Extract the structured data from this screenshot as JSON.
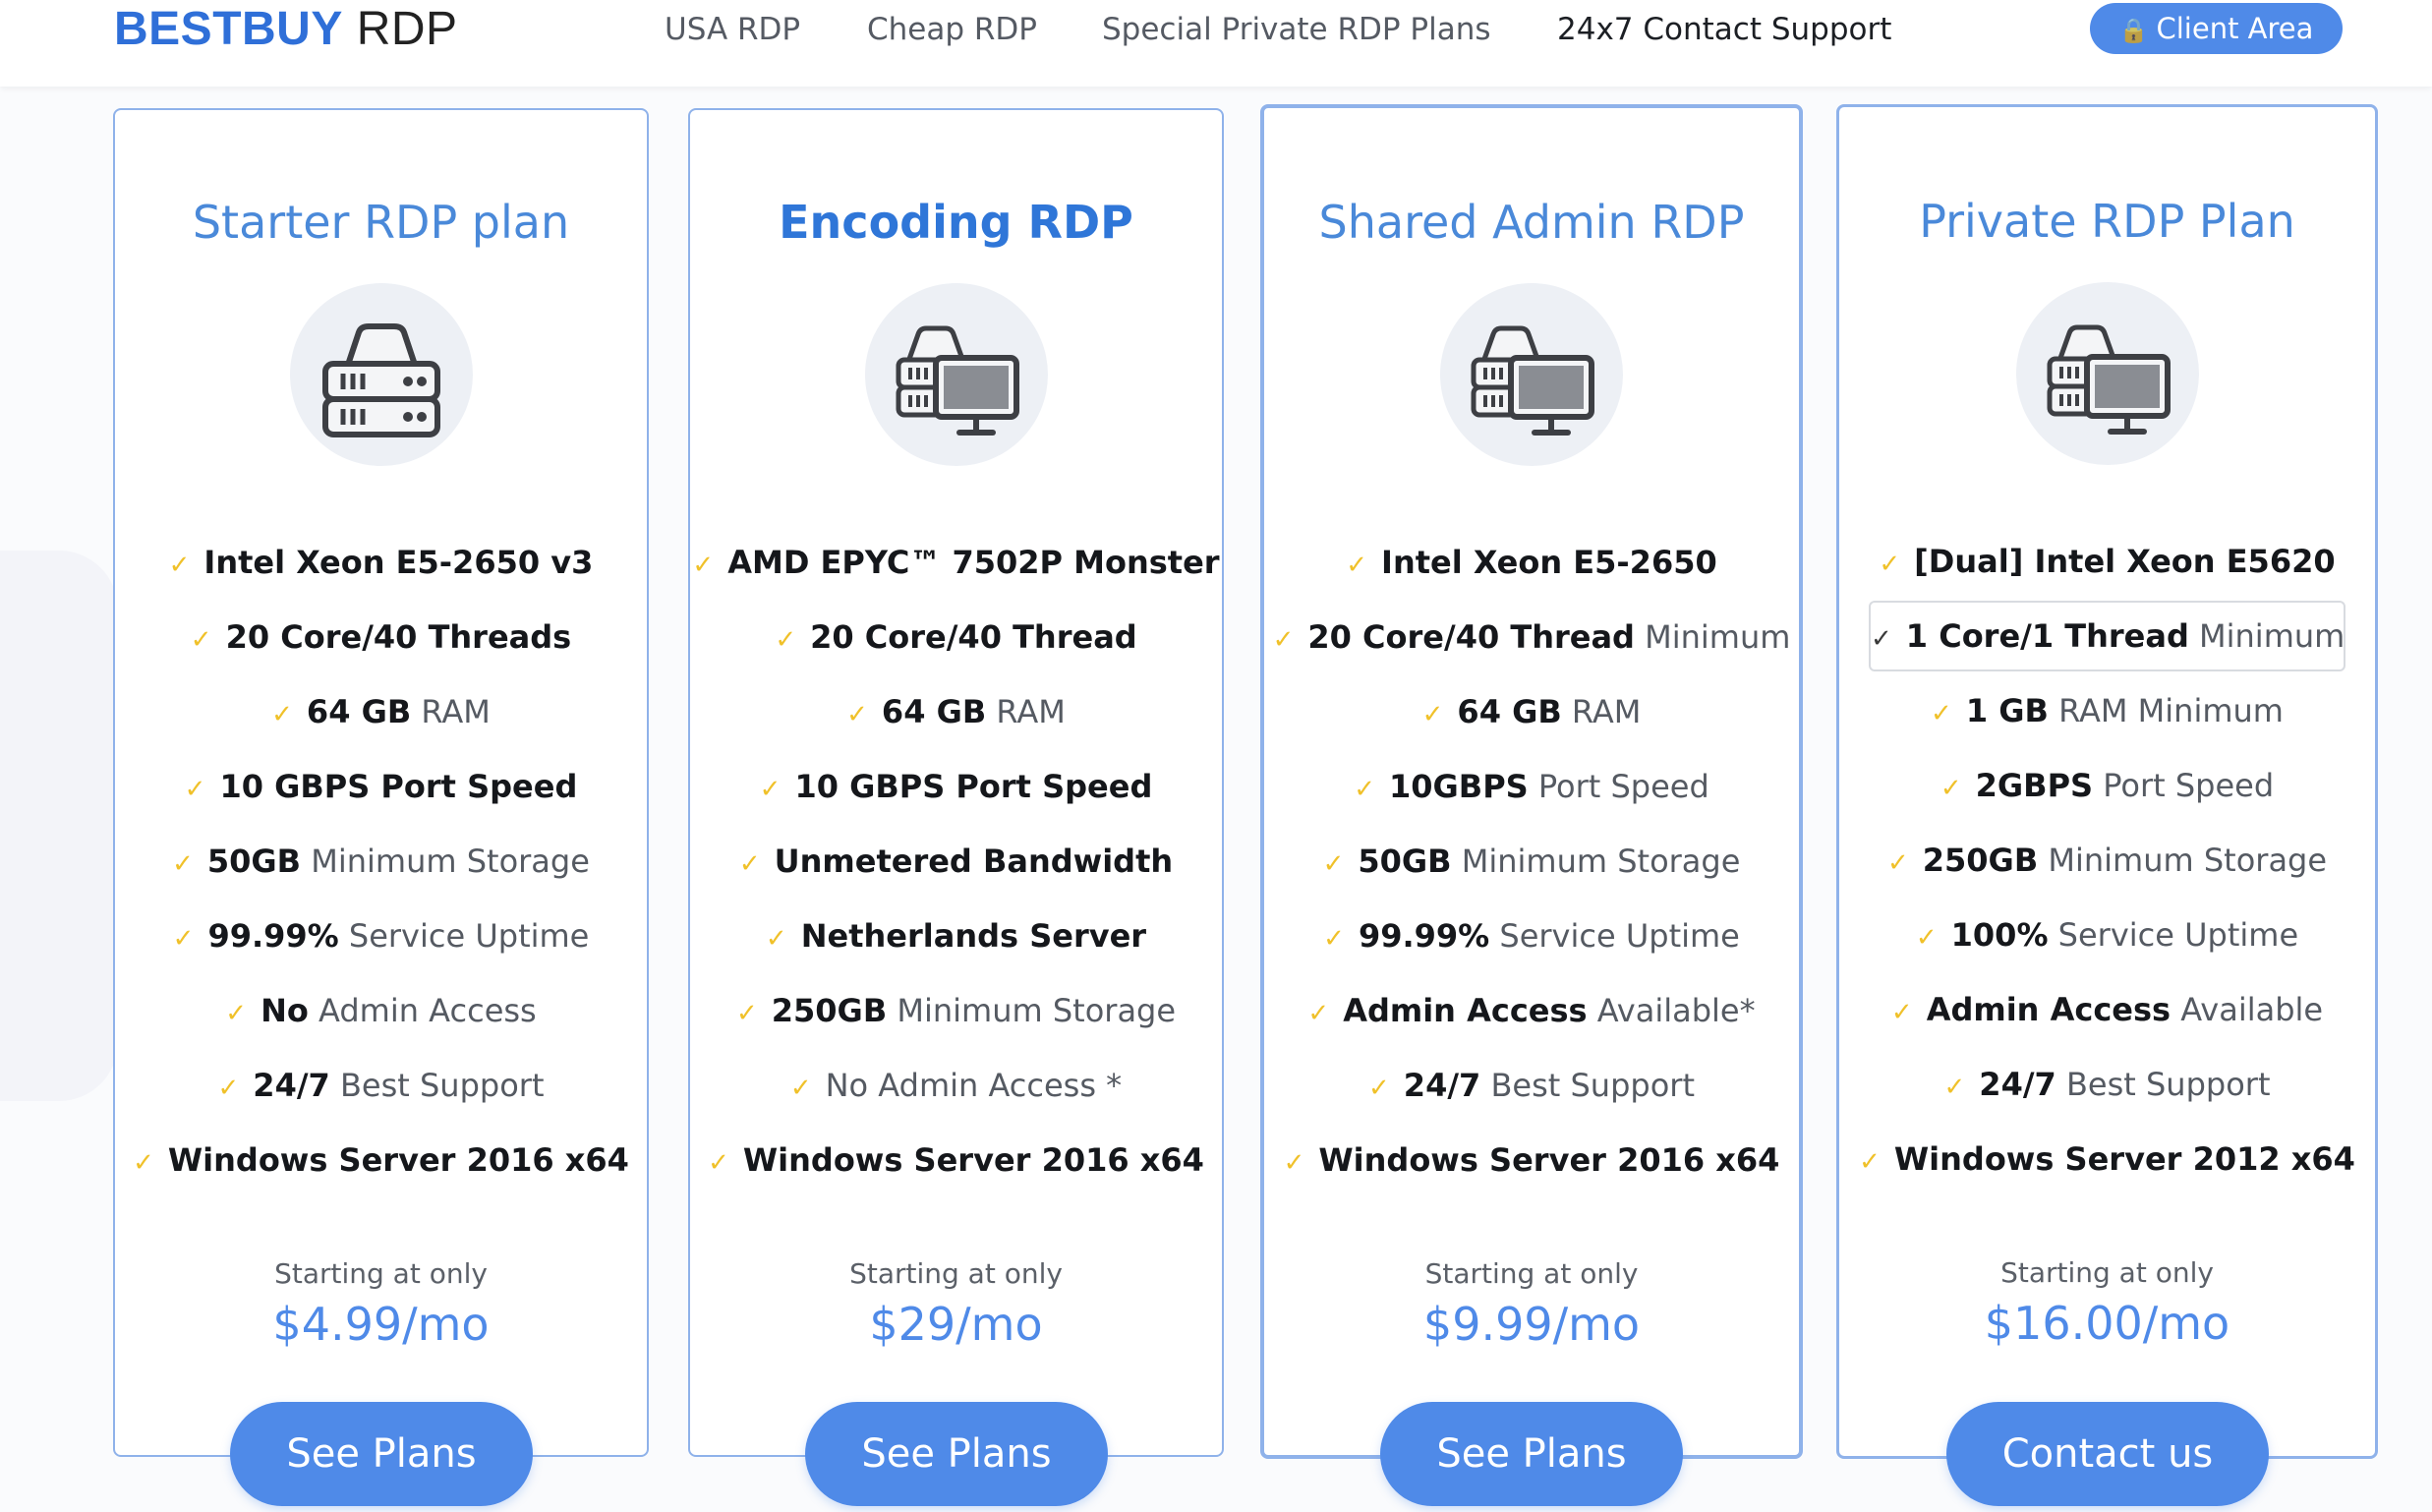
{
  "header": {
    "logo_brand": "BESTBUY",
    "logo_suffix": "RDP",
    "nav": [
      "USA RDP",
      "Cheap RDP",
      "Special Private RDP Plans",
      "24x7 Contact Support"
    ],
    "client_area": "Client Area"
  },
  "icons": {
    "server": "server-icon",
    "server_monitor": "server-monitor-icon",
    "check": "check-icon",
    "lock": "lock-icon"
  },
  "colors": {
    "accent": "#4f8ae8",
    "brand": "#2f6fd8",
    "check": "#f0c12a",
    "border": "#8fb2ea"
  },
  "plans": [
    {
      "title": "Starter RDP plan",
      "features": [
        {
          "bold": "Intel Xeon E5-2650 v3",
          "light": ""
        },
        {
          "bold": "20 Core/40 Threads",
          "light": ""
        },
        {
          "bold": "64 GB",
          "light": " RAM"
        },
        {
          "bold": "10 GBPS Port Speed",
          "light": ""
        },
        {
          "bold": "50GB",
          "light": " Minimum Storage"
        },
        {
          "bold": "99.99%",
          "light": " Service Uptime"
        },
        {
          "bold": "No",
          "light": " Admin Access"
        },
        {
          "bold": "24/7",
          "light": " Best Support"
        },
        {
          "bold": "Windows Server 2016 x64",
          "light": ""
        }
      ],
      "starting": "Starting at only",
      "price": "$4.99/mo",
      "button": "See Plans"
    },
    {
      "title": "Encoding RDP",
      "features": [
        {
          "bold": "AMD EPYC™ 7502P Monster",
          "light": ""
        },
        {
          "bold": "20 Core/40 Thread",
          "light": ""
        },
        {
          "bold": "64 GB",
          "light": " RAM"
        },
        {
          "bold": "10 GBPS Port Speed",
          "light": ""
        },
        {
          "bold": "Unmetered Bandwidth",
          "light": ""
        },
        {
          "bold": "Netherlands Server",
          "light": ""
        },
        {
          "bold": "250GB",
          "light": " Minimum Storage"
        },
        {
          "bold": "",
          "light": "No Admin Access *"
        },
        {
          "bold": "Windows Server 2016 x64",
          "light": ""
        }
      ],
      "starting": "Starting at only",
      "price": "$29/mo",
      "button": "See Plans"
    },
    {
      "title": "Shared Admin RDP",
      "features": [
        {
          "bold": "Intel Xeon E5-2650",
          "light": ""
        },
        {
          "bold": "20 Core/40 Thread",
          "light": " Minimum"
        },
        {
          "bold": "64 GB",
          "light": " RAM"
        },
        {
          "bold": "10GBPS",
          "light": " Port Speed"
        },
        {
          "bold": "50GB",
          "light": " Minimum Storage"
        },
        {
          "bold": "99.99%",
          "light": " Service Uptime"
        },
        {
          "bold": "Admin Access",
          "light": " Available*"
        },
        {
          "bold": "24/7",
          "light": " Best Support"
        },
        {
          "bold": "Windows Server 2016 x64",
          "light": ""
        }
      ],
      "starting": "Starting at only",
      "price": "$9.99/mo",
      "button": "See Plans"
    },
    {
      "title": "Private RDP Plan",
      "features": [
        {
          "bold": "[Dual] Intel Xeon E5620",
          "light": ""
        },
        {
          "bold": "1 Core/1 Thread",
          "light": " Minimum"
        },
        {
          "bold": "1 GB",
          "light": " RAM Minimum"
        },
        {
          "bold": "2GBPS",
          "light": " Port Speed"
        },
        {
          "bold": "250GB",
          "light": " Minimum Storage"
        },
        {
          "bold": "100%",
          "light": " Service Uptime"
        },
        {
          "bold": "Admin Access",
          "light": " Available"
        },
        {
          "bold": "24/7",
          "light": " Best Support"
        },
        {
          "bold": "Windows Server 2012 x64",
          "light": ""
        }
      ],
      "starting": "Starting at only",
      "price": "$16.00/mo",
      "button": "Contact us"
    }
  ]
}
